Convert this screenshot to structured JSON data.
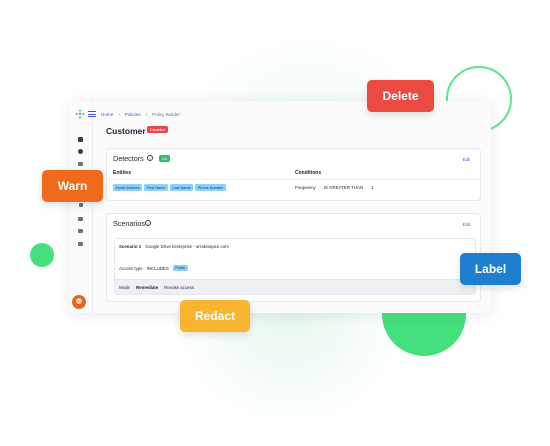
{
  "breadcrumb": {
    "home": "Home",
    "policies": "Policies",
    "current": "Policy Builder"
  },
  "page": {
    "title": "Customer",
    "status": "Disabled"
  },
  "detectors": {
    "title": "Detectors",
    "status": "On",
    "edit_label": "Edit",
    "entities_header": "Entities",
    "conditions_header": "Conditions",
    "entities": [
      "Email Address",
      "First Name",
      "Last Name",
      "Phone Number"
    ],
    "condition": {
      "field": "Frequency",
      "operator": "IS GREATER THAN",
      "value": "1"
    }
  },
  "scenarios": {
    "title": "Scenarios",
    "edit_label": "Edit",
    "scenario": {
      "label": "Scenario 1",
      "name": "Google Drive Enterprise - arrakisspice.com",
      "access_label": "Access type",
      "access_op": "INCLUDES",
      "access_value": "Public",
      "mode_label": "Mode",
      "mode_value": "Remediate",
      "mode_action": "Revoke access"
    }
  },
  "sidebar_icons": [
    "logo-icon",
    "grid-icon",
    "globe-icon",
    "layers-icon",
    "edit-icon",
    "user-icon",
    "print-icon",
    "chart-icon",
    "avatar"
  ],
  "action_pills": {
    "delete": "Delete",
    "warn": "Warn",
    "label": "Label",
    "redact": "Redact"
  },
  "colors": {
    "delete": "#ea4a41",
    "warn": "#f06a1c",
    "label": "#1e7fd0",
    "redact": "#f8b52f",
    "accent_green": "#44e07e",
    "link": "#3a5bd0",
    "chip": "#8fd0f5",
    "disabled": "#e5484d",
    "on": "#2fbf71"
  }
}
